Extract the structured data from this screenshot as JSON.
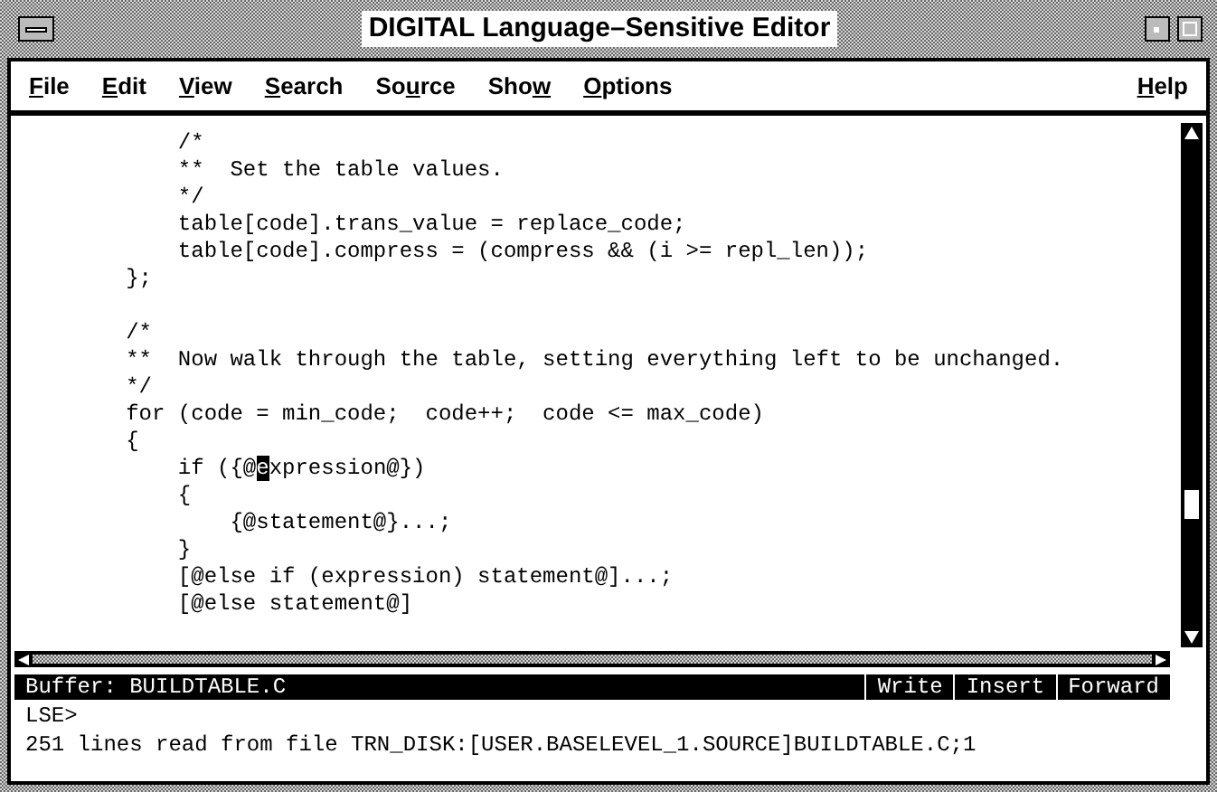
{
  "window": {
    "title": "DIGITAL Language–Sensitive Editor"
  },
  "menu": {
    "items": [
      {
        "underlined": "F",
        "rest": "ile"
      },
      {
        "underlined": "E",
        "rest": "dit"
      },
      {
        "underlined": "V",
        "rest": "iew"
      },
      {
        "underlined": "S",
        "rest": "earch"
      },
      {
        "before": "So",
        "underlined": "u",
        "rest": "rce"
      },
      {
        "before": "Sho",
        "underlined": "w"
      },
      {
        "underlined": "O",
        "rest": "ptions"
      }
    ],
    "help": {
      "underlined": "H",
      "rest": "elp"
    }
  },
  "code_blocks": [
    {
      "lines": [
        {
          "text": "            /*"
        },
        {
          "text": "            **  Set the table values."
        },
        {
          "text": "            */"
        },
        {
          "text": "            table[code].trans_value = replace_code;"
        },
        {
          "text": "            table[code].compress = (compress && (i >= repl_len));"
        },
        {
          "text": "        };"
        }
      ]
    },
    {
      "lines": [
        {
          "text": "        /*"
        },
        {
          "text": "        **  Now walk through the table, setting everything left to be unchanged."
        },
        {
          "text": "        */"
        },
        {
          "text": "        for (code = min_code;  code++;  code <= max_code)"
        },
        {
          "text": "        {"
        },
        {
          "text": "            if ({@",
          "cursor": "e",
          "after": "xpression@})"
        },
        {
          "text": "            {"
        },
        {
          "text": "                {@statement@}...;"
        },
        {
          "text": "            }"
        },
        {
          "text": "            [@else if (expression) statement@]...;"
        },
        {
          "text": "            [@else statement@]"
        }
      ]
    }
  ],
  "status_bar": {
    "buffer": "Buffer: BUILDTABLE.C",
    "modes": [
      "Write",
      "Insert",
      "Forward"
    ]
  },
  "prompt": "LSE>",
  "message": "251 lines read from file TRN_DISK:[USER.BASELEVEL_1.SOURCE]BUILDTABLE.C;1"
}
